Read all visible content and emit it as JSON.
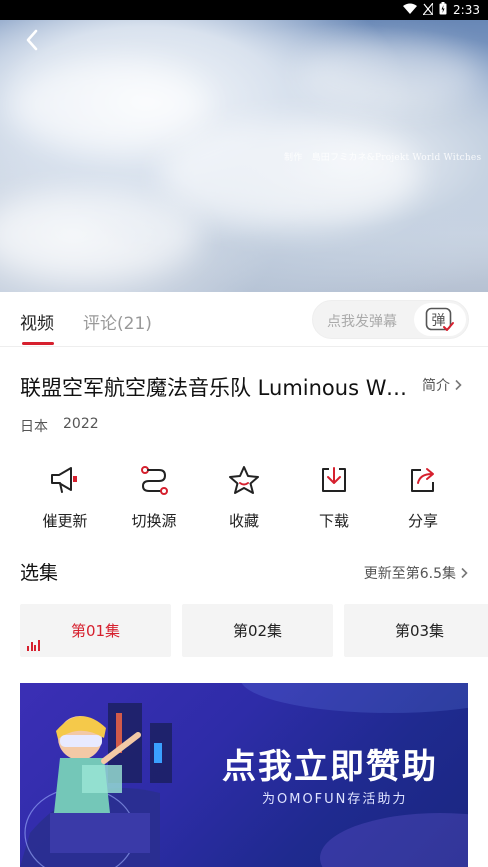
{
  "status_bar": {
    "time": "2:33"
  },
  "video": {
    "watermark": "制作　島田フミカネ&Projekt World Witches"
  },
  "tabs": [
    {
      "label": "视频"
    },
    {
      "label": "评论(21)"
    }
  ],
  "danmaku": {
    "placeholder": "点我发弹幕",
    "button_label": "弹"
  },
  "details": {
    "title": "联盟空军航空魔法音乐队 Luminous Witches",
    "intro_label": "简介",
    "region": "日本",
    "year": "2022"
  },
  "actions": [
    {
      "label": "催更新",
      "icon": "megaphone-icon"
    },
    {
      "label": "切换源",
      "icon": "switch-source-icon"
    },
    {
      "label": "收藏",
      "icon": "star-icon"
    },
    {
      "label": "下载",
      "icon": "download-icon"
    },
    {
      "label": "分享",
      "icon": "share-icon"
    }
  ],
  "episodes": {
    "title": "选集",
    "update_text": "更新至第6.5集",
    "items": [
      {
        "label": "第01集",
        "active": true
      },
      {
        "label": "第02集",
        "active": false
      },
      {
        "label": "第03集",
        "active": false
      }
    ]
  },
  "banner": {
    "main_text": "点我立即赞助",
    "sub_text": "为OMOFUN存活助力"
  },
  "colors": {
    "accent": "#d6202e",
    "banner_bg": "#2e2ca8"
  }
}
